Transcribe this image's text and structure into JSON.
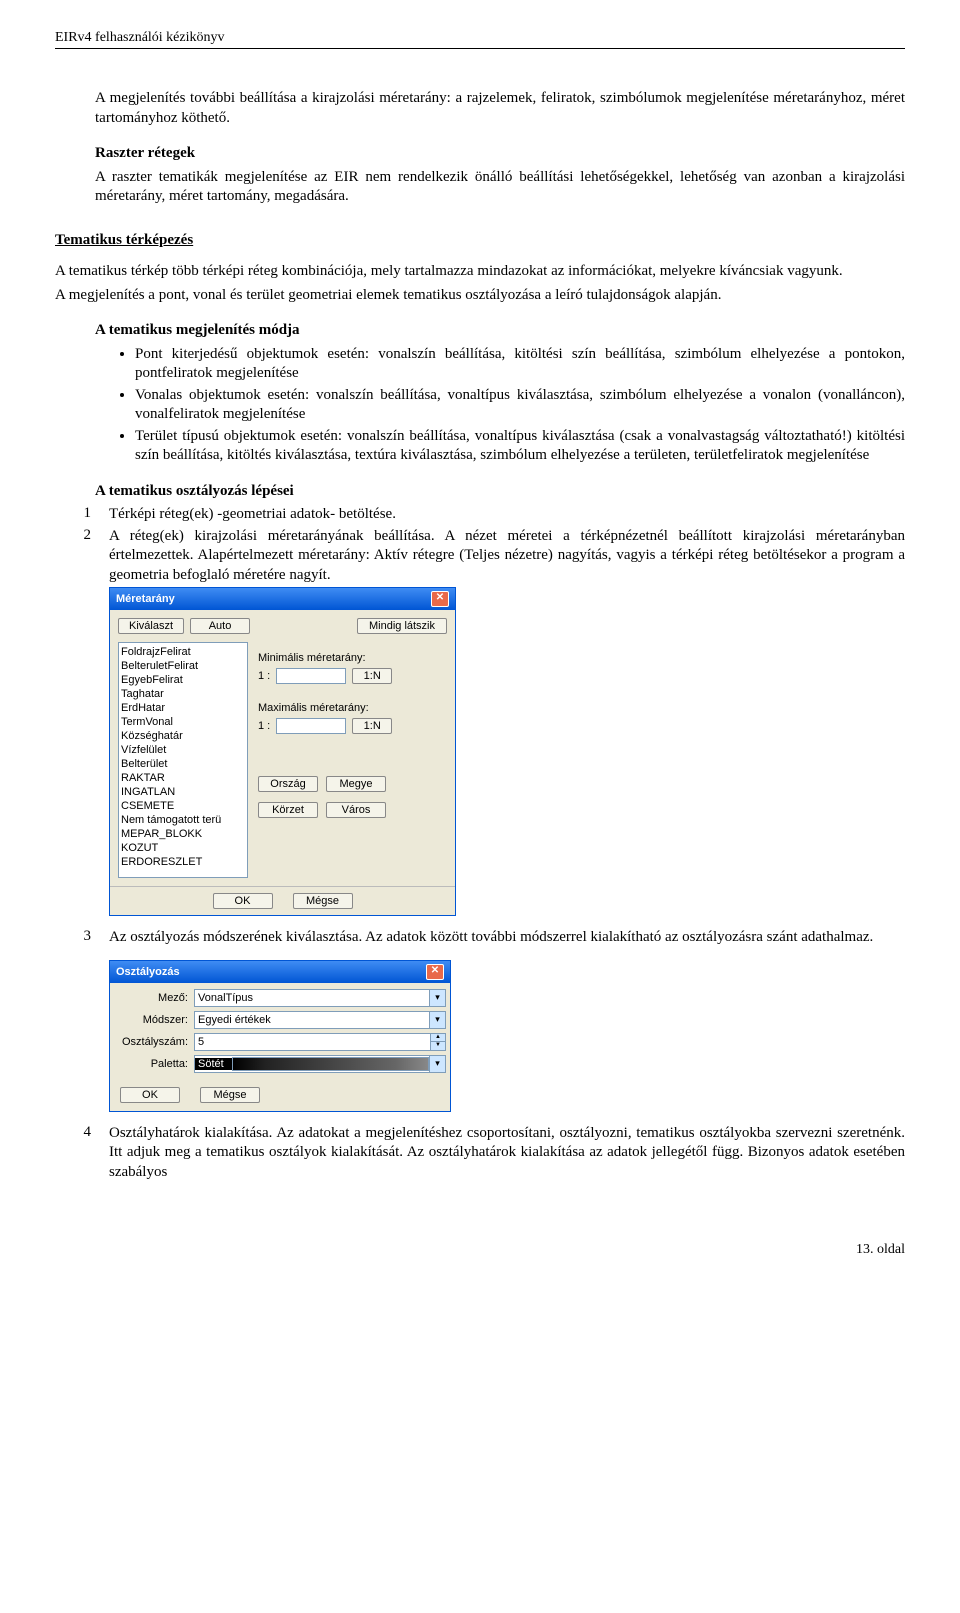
{
  "header": "EIRv4 felhasználói kézikönyv",
  "p1": "A megjelenítés további beállítása a kirajzolási méretarány: a rajzelemek, feliratok, szimbólumok megjelenítése méretarányhoz, méret tartományhoz köthető.",
  "raster_title": "Raszter rétegek",
  "raster_body": "A raszter tematikák megjelenítése az EIR nem rendelkezik önálló beállítási lehetőségekkel, lehetőség van azonban a kirajzolási méretarány, méret tartomány, megadására.",
  "section_title": "Tematikus térképezés",
  "p2": "A tematikus térkép több térképi réteg kombinációja, mely tartalmazza mindazokat az információkat, melyekre kíváncsiak vagyunk.",
  "p3": "A megjelenítés a pont, vonal és terület geometriai elemek tematikus osztályozása a leíró tulajdonságok alapján.",
  "mode_title": "A tematikus megjelenítés módja",
  "bullets": [
    "Pont kiterjedésű objektumok esetén: vonalszín beállítása, kitöltési szín beállítása, szimbólum elhelyezése a pontokon, pontfeliratok megjelenítése",
    "Vonalas objektumok esetén: vonalszín beállítása, vonaltípus kiválasztása, szimbólum elhelyezése a vonalon (vonalláncon), vonalfeliratok megjelenítése",
    "Terület típusú objektumok esetén: vonalszín beállítása, vonaltípus kiválasztása (csak a vonalvastagság változtatható!) kitöltési szín beállítása, kitöltés kiválasztása, textúra kiválasztása, szimbólum elhelyezése a területen, területfeliratok megjelenítése"
  ],
  "class_title": "A tematikus osztályozás lépései",
  "step1": "Térképi réteg(ek) -geometriai adatok- betöltése.",
  "step2": "A réteg(ek) kirajzolási méretarányának beállítása. A nézet méretei a térképnézetnél beállított kirajzolási méretarányban értelmezettek. Alapértelmezett méretarány: Aktív rétegre (Teljes nézetre) nagyítás, vagyis a térképi réteg betöltésekor a program a geometria befoglaló méretére nagyít.",
  "step3": "Az osztályozás módszerének kiválasztása. Az adatok között további módszerrel kialakítható az osztályozásra szánt adathalmaz.",
  "step4": "Osztályhatárok kialakítása. Az adatokat a megjelenítéshez csoportosítani, osztályozni, tematikus osztályokba szervezni szeretnénk. Itt adjuk meg a tematikus osztályok kialakítását. Az osztályhatárok kialakítása az adatok jellegétől függ. Bizonyos adatok esetében szabályos",
  "dlg1": {
    "title": "Méretarány",
    "btn_kivalaszt": "Kiválaszt",
    "btn_auto": "Auto",
    "btn_mindig": "Mindig látszik",
    "list": [
      "FoldrajzFelirat",
      "BelteruletFelirat",
      "EgyebFelirat",
      "Taghatar",
      "ErdHatar",
      "TermVonal",
      "Községhatár",
      "Vízfelület",
      "Belterület",
      "RAKTAR",
      "INGATLAN",
      "CSEMETE",
      "Nem támogatott terü",
      "MEPAR_BLOKK",
      "KOZUT",
      "ERDORESZLET"
    ],
    "min_lbl": "Minimális méretarány:",
    "max_lbl": "Maximális méretarány:",
    "one": "1 :",
    "btn_1n": "1:N",
    "btn_orszag": "Ország",
    "btn_megye": "Megye",
    "btn_korzet": "Körzet",
    "btn_varos": "Város",
    "ok": "OK",
    "cancel": "Mégse"
  },
  "dlg2": {
    "title": "Osztályozás",
    "mezo_lbl": "Mező:",
    "mezo_val": "VonalTípus",
    "modszer_lbl": "Módszer:",
    "modszer_val": "Egyedi értékek",
    "oszt_lbl": "Osztályszám:",
    "oszt_val": "5",
    "paletta_lbl": "Paletta:",
    "paletta_val": "Sötét",
    "ok": "OK",
    "cancel": "Mégse"
  },
  "footer": "13. oldal"
}
